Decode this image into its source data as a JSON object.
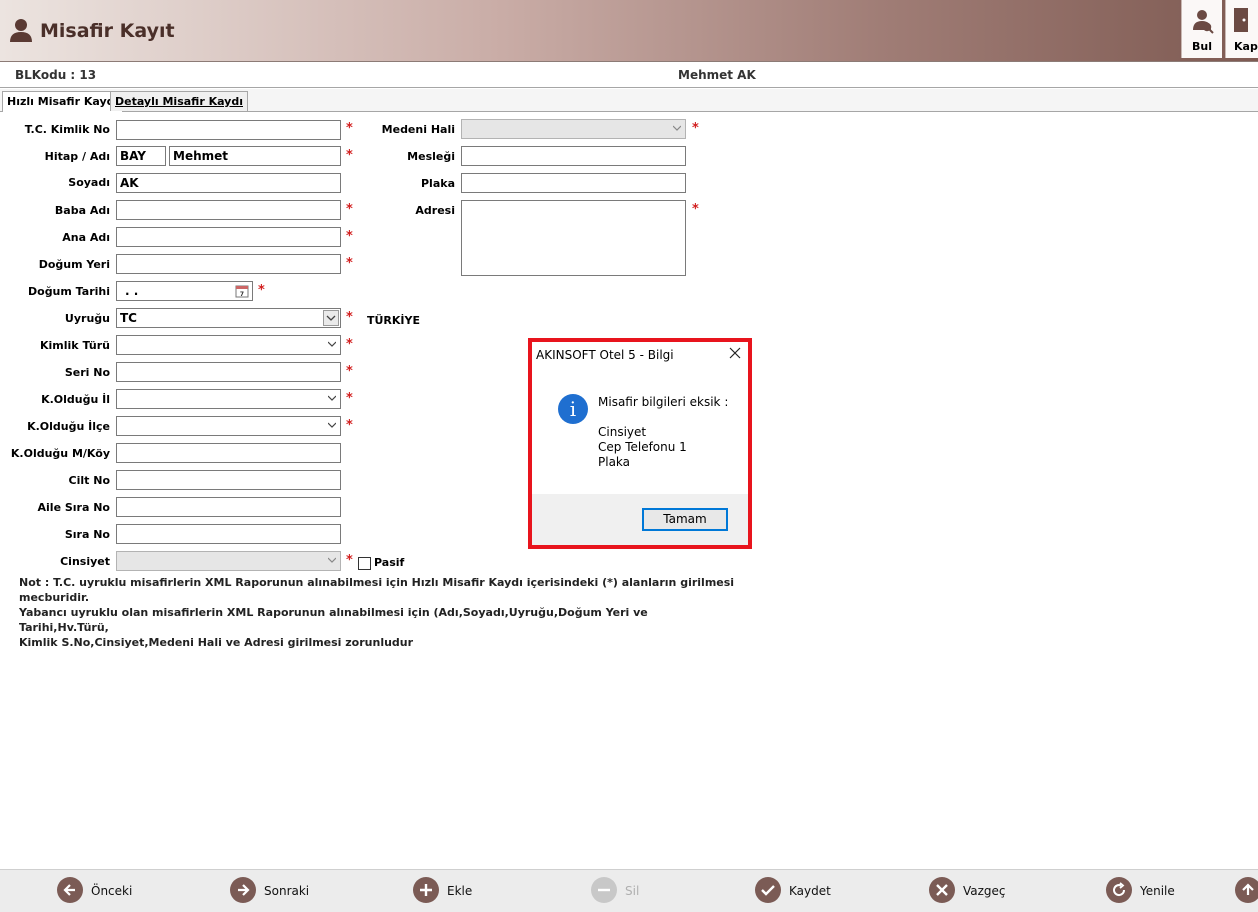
{
  "header": {
    "title": "Misafir Kayıt",
    "buttons": [
      {
        "label": "Bul",
        "icon": "user-search-icon"
      },
      {
        "label": "Kapa",
        "icon": "door-close-icon"
      }
    ]
  },
  "infobar": {
    "blkodu": "BLKodu : 13",
    "guest_name": "Mehmet AK"
  },
  "tabs": [
    {
      "label": "Hızlı Misafir Kaydı",
      "active": true
    },
    {
      "label": "Detaylı Misafir Kaydı",
      "active": false
    }
  ],
  "form": {
    "tc_label": "T.C. Kimlik No",
    "tc_value": "",
    "hitap_label": "Hitap / Adı",
    "hitap_value": "BAY",
    "adi_value": "Mehmet",
    "soyadi_label": "Soyadı",
    "soyadi_value": "AK",
    "baba_label": "Baba Adı",
    "baba_value": "",
    "ana_label": "Ana Adı",
    "ana_value": "",
    "dogum_yeri_label": "Doğum Yeri",
    "dogum_yeri_value": "",
    "dogum_tarihi_label": "Doğum Tarihi",
    "dogum_tarihi_value": ". .",
    "uyrugu_label": "Uyruğu",
    "uyrugu_value": "TC",
    "uyrugu_text": "TÜRKİYE",
    "kimlik_turu_label": "Kimlik Türü",
    "kimlik_turu_value": "",
    "seri_label": "Seri No",
    "seri_value": "",
    "il_label": "K.Olduğu İl",
    "il_value": "",
    "ilce_label": "K.Olduğu İlçe",
    "ilce_value": "",
    "mkoy_label": "K.Olduğu M/Köy",
    "mkoy_value": "",
    "cilt_label": "Cilt No",
    "cilt_value": "",
    "aile_label": "Aile Sıra No",
    "aile_value": "",
    "sira_label": "Sıra No",
    "sira_value": "",
    "cinsiyet_label": "Cinsiyet",
    "cinsiyet_value": "",
    "pasif_label": "Pasif",
    "medeni_label": "Medeni Hali",
    "medeni_value": "",
    "meslegi_label": "Mesleği",
    "meslegi_value": "",
    "plaka_label": "Plaka",
    "plaka_value": "",
    "adresi_label": "Adresi",
    "adresi_value": "",
    "required_mark": "*"
  },
  "note": {
    "line1": "Not : T.C. uyruklu misafirlerin XML Raporunun alınabilmesi için Hızlı Misafir Kaydı içerisindeki (*) alanların girilmesi mecburidir.",
    "line2": "Yabancı uyruklu olan misafirlerin XML Raporunun alınabilmesi için (Adı,Soyadı,Uyruğu,Doğum Yeri ve Tarihi,Hv.Türü,",
    "line3": "Kimlik S.No,Cinsiyet,Medeni Hali ve Adresi girilmesi zorunludur"
  },
  "dialog": {
    "title": "AKINSOFT Otel 5 - Bilgi",
    "icon_letter": "i",
    "heading": "Misafir bilgileri eksik :",
    "missing": [
      "Cinsiyet",
      "Cep Telefonu 1",
      "Plaka"
    ],
    "ok_label": "Tamam"
  },
  "bottom": [
    {
      "label": "Önceki",
      "icon": "arrow-left-icon",
      "enabled": true
    },
    {
      "label": "Sonraki",
      "icon": "arrow-right-icon",
      "enabled": true
    },
    {
      "label": "Ekle",
      "icon": "plus-icon",
      "enabled": true
    },
    {
      "label": "Sil",
      "icon": "minus-icon",
      "enabled": false
    },
    {
      "label": "Kaydet",
      "icon": "check-icon",
      "enabled": true
    },
    {
      "label": "Vazgeç",
      "icon": "x-icon",
      "enabled": true
    },
    {
      "label": "Yenile",
      "icon": "refresh-icon",
      "enabled": true
    },
    {
      "label": "",
      "icon": "arrow-up-icon",
      "enabled": true
    }
  ],
  "colors": {
    "brand": "#7e5a52",
    "required": "#d21e1e",
    "dialog_border": "#e8141d",
    "info_blue": "#1f6fd0"
  }
}
